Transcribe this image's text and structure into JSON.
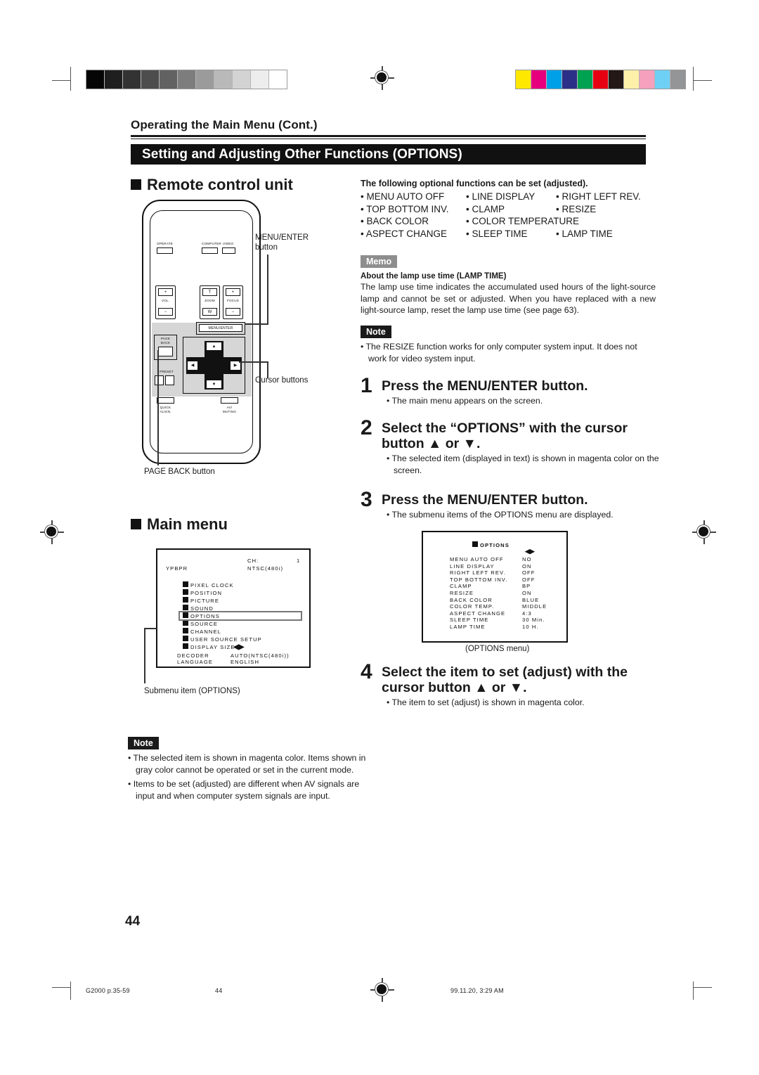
{
  "running_head": "Operating the Main Menu (Cont.)",
  "banner_title": "Setting and Adjusting Other Functions (OPTIONS)",
  "sections": {
    "remote_heading": "Remote control unit",
    "main_menu_heading": "Main menu"
  },
  "functions": {
    "lead": "The following optional functions can be set (adjusted).",
    "items": [
      "• MENU AUTO OFF",
      "• LINE DISPLAY",
      "• RIGHT LEFT REV.",
      "• TOP BOTTOM INV.",
      "• CLAMP",
      "• RESIZE",
      "• BACK COLOR",
      "• COLOR TEMPERATURE",
      "",
      "• ASPECT CHANGE",
      "• SLEEP TIME",
      "• LAMP TIME"
    ]
  },
  "memo": {
    "tag": "Memo",
    "title": "About the lamp use time (LAMP TIME)",
    "body": "The lamp use time indicates the accumulated used hours of the light-source lamp and cannot be set or adjusted. When you have replaced with a new light-source lamp, reset the lamp use time (see page 63)."
  },
  "note_top": {
    "tag": "Note",
    "items": [
      "• The RESIZE function works for only computer system input. It does not work for video system input."
    ]
  },
  "note_bottom": {
    "tag": "Note",
    "items": [
      "• The selected item is shown in magenta color. Items shown in gray color cannot be operated or set in the current mode.",
      "• Items to be set (adjusted) are different when AV signals are input and when computer system signals are input."
    ]
  },
  "steps": [
    {
      "num": "1",
      "head": "Press the MENU/ENTER button.",
      "bullets": [
        "• The main menu appears on the screen."
      ]
    },
    {
      "num": "2",
      "head": "Select the “OPTIONS” with the cursor button ▲ or ▼.",
      "bullets": [
        "• The selected item (displayed in text) is shown in magenta color on the screen."
      ]
    },
    {
      "num": "3",
      "head": "Press the MENU/ENTER button.",
      "bullets": [
        "• The submenu items of the OPTIONS menu are displayed."
      ]
    },
    {
      "num": "4",
      "head": "Select the item to set (adjust) with the cursor button ▲ or ▼.",
      "bullets": [
        "• The item to set (adjust) is shown in magenta color."
      ]
    }
  ],
  "remote": {
    "buttons": {
      "operate": "OPERATE",
      "computer": "COMPUTER",
      "video": "VIDEO",
      "vol": "VOL.",
      "vol_plus": "+",
      "vol_minus": "−",
      "zoom": "ZOOM",
      "zoom_t": "T",
      "zoom_w": "W",
      "focus": "FOCUS",
      "focus_plus": "+",
      "focus_minus": "−",
      "menu_enter": "MENU/ENTER",
      "page": "PAGE",
      "back": "BACK",
      "preset": "PRESET",
      "quick": "QUICK",
      "align": "ALIGN.",
      "av": "AV/",
      "muting": "MUTING",
      "cursor_up": "▲",
      "cursor_down": "▼",
      "cursor_left": "◀",
      "cursor_right": "▶"
    },
    "callouts": {
      "menu_enter": "MENU/ENTER\nbutton",
      "cursor": "Cursor buttons",
      "page_back": "PAGE BACK button"
    }
  },
  "main_menu_osd": {
    "source": "YPBPR",
    "ch_label": "CH:",
    "ch_value": "1",
    "signal": "NTSC(480i)",
    "items": [
      "PIXEL CLOCK",
      "POSITION",
      "PICTURE",
      "SOUND",
      "OPTIONS",
      "SOURCE",
      "CHANNEL",
      "USER SOURCE SETUP",
      "DISPLAY SIZE"
    ],
    "selected_item": "OPTIONS",
    "arrows": "◀▶",
    "footer_rows": [
      {
        "label": "DECODER",
        "value": "AUTO(NTSC(480i))"
      },
      {
        "label": "LANGUAGE",
        "value": "ENGLISH"
      }
    ],
    "caption": "Submenu item (OPTIONS)"
  },
  "options_osd": {
    "title": "OPTIONS",
    "arrows": "◀▶",
    "rows": [
      {
        "label": "MENU AUTO OFF",
        "value": "NO"
      },
      {
        "label": "LINE DISPLAY",
        "value": "ON"
      },
      {
        "label": "RIGHT LEFT REV.",
        "value": "OFF"
      },
      {
        "label": "TOP BOTTOM INV.",
        "value": "OFF"
      },
      {
        "label": "CLAMP",
        "value": "BP"
      },
      {
        "label": "RESIZE",
        "value": "ON"
      },
      {
        "label": "BACK COLOR",
        "value": "BLUE"
      },
      {
        "label": "COLOR TEMP.",
        "value": "MIDDLE"
      },
      {
        "label": "ASPECT CHANGE",
        "value": "4:3"
      },
      {
        "label": "SLEEP TIME",
        "value": "30   Min."
      },
      {
        "label": "LAMP TIME",
        "value": "10   H."
      }
    ],
    "caption": "(OPTIONS menu)"
  },
  "page_number": "44",
  "footer": {
    "file": "G2000  p.35-59",
    "page": "44",
    "timestamp": "99.11.20, 3:29 AM"
  },
  "print_marks": {
    "greyscale": [
      "#050505",
      "#1f1f1f",
      "#333333",
      "#4d4d4d",
      "#626262",
      "#7d7d7d",
      "#9b9b9b",
      "#b9b9b9",
      "#d3d3d3",
      "#ededed",
      "#ffffff"
    ],
    "colors": [
      "#ffe800",
      "#e6007e",
      "#00a0e9",
      "#2b2f87",
      "#00a150",
      "#e60012",
      "#231815",
      "#fdf0a8",
      "#f5a0bd",
      "#6fd0f5",
      "#949596"
    ]
  }
}
